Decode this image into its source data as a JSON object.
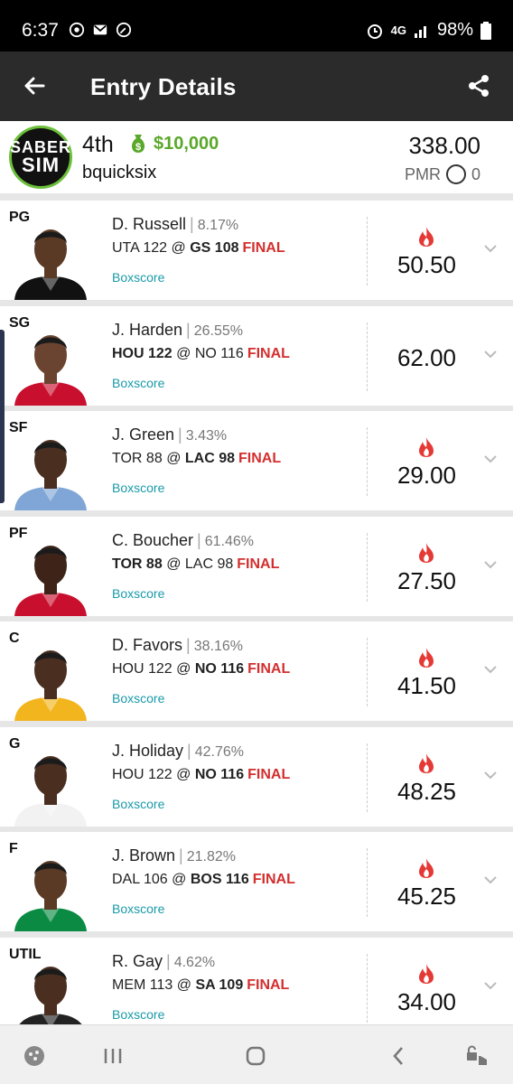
{
  "status_bar": {
    "time": "6:37",
    "network": "4G",
    "battery": "98%"
  },
  "app_bar": {
    "title": "Entry Details"
  },
  "entry": {
    "logo_line1": "SABER",
    "logo_line2": "SIM",
    "rank": "4th",
    "prize": "$10,000",
    "username": "bquicksix",
    "total_score": "338.00",
    "pmr_label": "PMR",
    "pmr_value": "0"
  },
  "players": [
    {
      "pos": "PG",
      "name": "D. Russell",
      "own": "8.17%",
      "away": "UTA 122",
      "at": "@",
      "home": "GS 108",
      "bold": "home",
      "status": "FINAL",
      "boxscore": "Boxscore",
      "points": "50.50",
      "hot": true,
      "jersey": "#111111",
      "skin": "#5a3a24"
    },
    {
      "pos": "SG",
      "name": "J. Harden",
      "own": "26.55%",
      "away": "HOU 122",
      "at": "@",
      "home": "NO 116",
      "bold": "away",
      "status": "FINAL",
      "boxscore": "Boxscore",
      "points": "62.00",
      "hot": false,
      "jersey": "#c8102e",
      "skin": "#6b4431"
    },
    {
      "pos": "SF",
      "name": "J. Green",
      "own": "3.43%",
      "away": "TOR 88",
      "at": "@",
      "home": "LAC 98",
      "bold": "home",
      "status": "FINAL",
      "boxscore": "Boxscore",
      "points": "29.00",
      "hot": true,
      "jersey": "#7fa6d6",
      "skin": "#4a2e20"
    },
    {
      "pos": "PF",
      "name": "C. Boucher",
      "own": "61.46%",
      "away": "TOR 88",
      "at": "@",
      "home": "LAC 98",
      "bold": "away",
      "status": "FINAL",
      "boxscore": "Boxscore",
      "points": "27.50",
      "hot": true,
      "jersey": "#c8102e",
      "skin": "#3e2418"
    },
    {
      "pos": "C",
      "name": "D. Favors",
      "own": "38.16%",
      "away": "HOU 122",
      "at": "@",
      "home": "NO 116",
      "bold": "home",
      "status": "FINAL",
      "boxscore": "Boxscore",
      "points": "41.50",
      "hot": true,
      "jersey": "#f2b51d",
      "skin": "#4a2e20"
    },
    {
      "pos": "G",
      "name": "J. Holiday",
      "own": "42.76%",
      "away": "HOU 122",
      "at": "@",
      "home": "NO 116",
      "bold": "home",
      "status": "FINAL",
      "boxscore": "Boxscore",
      "points": "48.25",
      "hot": true,
      "jersey": "#f2f2f2",
      "skin": "#4a2e20"
    },
    {
      "pos": "F",
      "name": "J. Brown",
      "own": "21.82%",
      "away": "DAL 106",
      "at": "@",
      "home": "BOS 116",
      "bold": "home",
      "status": "FINAL",
      "boxscore": "Boxscore",
      "points": "45.25",
      "hot": true,
      "jersey": "#0a8a43",
      "skin": "#5a3a24"
    },
    {
      "pos": "UTIL",
      "name": "R. Gay",
      "own": "4.62%",
      "away": "MEM 113",
      "at": "@",
      "home": "SA 109",
      "bold": "home",
      "status": "FINAL",
      "boxscore": "Boxscore",
      "points": "34.00",
      "hot": true,
      "jersey": "#222222",
      "skin": "#4a2e20"
    }
  ],
  "colors": {
    "accent_green": "#5aa82a",
    "final_red": "#d32f2f",
    "link_teal": "#1a9aa8",
    "flame_red": "#e53935"
  }
}
